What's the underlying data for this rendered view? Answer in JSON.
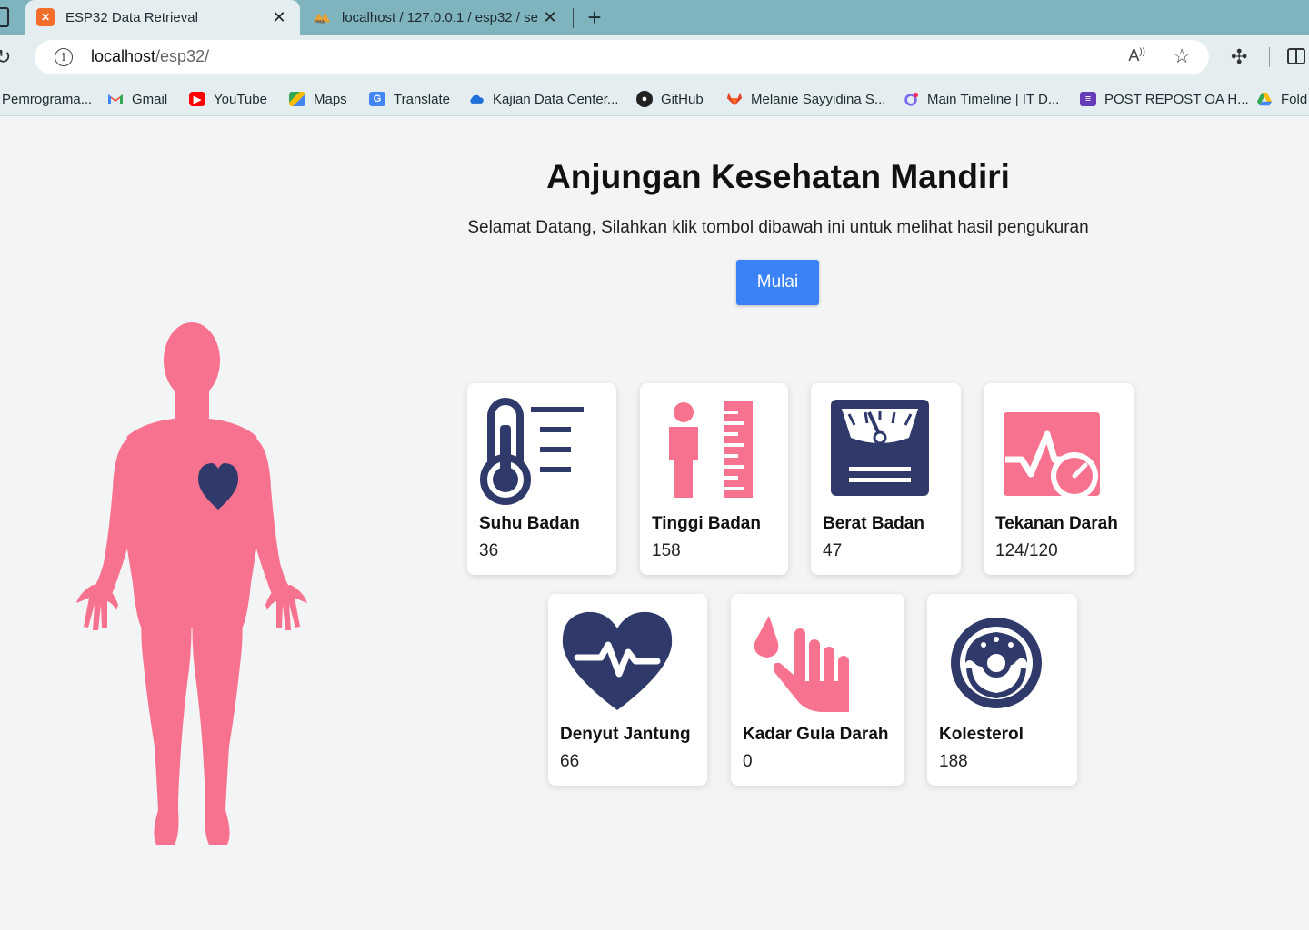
{
  "browser": {
    "tabs": [
      {
        "title": "ESP32 Data Retrieval",
        "active": true
      },
      {
        "title": "localhost / 127.0.0.1 / esp32 / se",
        "active": false
      }
    ],
    "address": {
      "host": "localhost",
      "path": "/esp32/"
    },
    "bookmarks": [
      {
        "label": "Pemrograma...",
        "icon": "bookmark-icon"
      },
      {
        "label": "Gmail",
        "icon": "gmail-icon"
      },
      {
        "label": "YouTube",
        "icon": "youtube-icon"
      },
      {
        "label": "Maps",
        "icon": "maps-icon"
      },
      {
        "label": "Translate",
        "icon": "translate-icon"
      },
      {
        "label": "Kajian Data Center...",
        "icon": "cloud-icon"
      },
      {
        "label": "GitHub",
        "icon": "github-icon"
      },
      {
        "label": "Melanie Sayyidina S...",
        "icon": "gitlab-icon"
      },
      {
        "label": "Main Timeline | IT D...",
        "icon": "clickup-icon"
      },
      {
        "label": "POST REPOST OA H...",
        "icon": "forms-icon"
      },
      {
        "label": "Fold",
        "icon": "drive-icon"
      }
    ]
  },
  "page": {
    "title": "Anjungan Kesehatan Mandiri",
    "subtitle": "Selamat Datang, Silahkan klik tombol dibawah ini untuk melihat hasil pengukuran",
    "start_button": "Mulai"
  },
  "colors": {
    "accent_blue": "#3b82f6",
    "pink": "#f7728f",
    "navy": "#2f3a6b",
    "background": "#f3f4f6"
  },
  "cards": [
    {
      "label": "Suhu Badan",
      "value": "36",
      "icon": "thermometer-icon"
    },
    {
      "label": "Tinggi Badan",
      "value": "158",
      "icon": "height-icon"
    },
    {
      "label": "Berat Badan",
      "value": "47",
      "icon": "scale-icon"
    },
    {
      "label": "Tekanan Darah",
      "value": "124/120",
      "icon": "blood-pressure-icon"
    },
    {
      "label": "Denyut Jantung",
      "value": "66",
      "icon": "heartbeat-icon"
    },
    {
      "label": "Kadar Gula Darah",
      "value": "0",
      "icon": "blood-sugar-icon"
    },
    {
      "label": "Kolesterol",
      "value": "188",
      "icon": "cholesterol-icon"
    }
  ]
}
